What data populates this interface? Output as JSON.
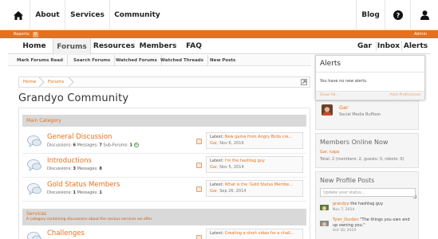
{
  "topnav": {
    "about": "About",
    "services": "Services",
    "community": "Community",
    "blog": "Blog"
  },
  "orangebar": {
    "reports_label": "Reports:",
    "reports_count": "0",
    "admin_label": "Admin"
  },
  "forumnav": {
    "tabs": [
      "Home",
      "Forums",
      "Resources",
      "Members",
      "FAQ"
    ],
    "right_tabs": [
      "Gar",
      "Inbox",
      "Alerts"
    ]
  },
  "subnav": {
    "links": [
      "Mark Forums Read",
      "Search Forums",
      "Watched Forums",
      "Watched Threads",
      "New Posts"
    ]
  },
  "breadcrumb": {
    "items": [
      "Home",
      "Forums"
    ]
  },
  "page": {
    "title": "Grandyo Community"
  },
  "categories": [
    {
      "title": "Main Category",
      "description": "",
      "forums": [
        {
          "name": "General Discussion",
          "discussions_label": "Discussions:",
          "discussions": "6",
          "messages_label": "Messages:",
          "messages": "7",
          "subforums_label": "Sub-Forums:",
          "subforums": "1",
          "latest_label": "Latest:",
          "latest_title": "New game from Angry Birds cre...",
          "latest_user": "Gar",
          "latest_date": "Nov 6, 2016"
        },
        {
          "name": "Introductions",
          "discussions_label": "Discussions:",
          "discussions": "3",
          "messages_label": "Messages:",
          "messages": "8",
          "latest_label": "Latest:",
          "latest_title": "I'm the hashtag guy",
          "latest_user": "Gar",
          "latest_date": "Nov 5, 2014"
        },
        {
          "name": "Gold Status Members",
          "discussions_label": "Discussions:",
          "discussions": "1",
          "messages_label": "Messages:",
          "messages": "1",
          "latest_label": "Latest:",
          "latest_title": "What is the 'Gold Status Membe...",
          "latest_user": "Gar",
          "latest_date": "Sep 26, 2014"
        }
      ]
    },
    {
      "title": "Services",
      "description": "A category containing discussions about the various services we offer.",
      "forums": [
        {
          "name": "Challenges",
          "latest_label": "Latest:",
          "latest_title": "Creating a short video for a chall..."
        }
      ]
    }
  ],
  "alerts": {
    "title": "Alerts",
    "empty": "You have no new alerts.",
    "show_all": "Show All...",
    "preferences": "Alert Preferences"
  },
  "visitor": {
    "name": "Gar",
    "title": "Social Media Buffoon"
  },
  "online": {
    "heading": "Members Online Now",
    "names": "Gar, kapa",
    "total": "Total: 2 (members: 2, guests: 0, robots: 0)"
  },
  "profile_posts": {
    "heading": "New Profile Posts",
    "placeholder": "Update your status...",
    "posts": [
      {
        "user": "grandyo",
        "text": " the hashtag guy",
        "date": "Nov 7, 2014"
      },
      {
        "user": "Tyler_Durden",
        "text": " \"The things you own end up owning you.\"",
        "date": "Oct 30, 2014"
      }
    ]
  },
  "colors": {
    "accent": "#e8701a",
    "category_bg": "#d9d9d9"
  }
}
